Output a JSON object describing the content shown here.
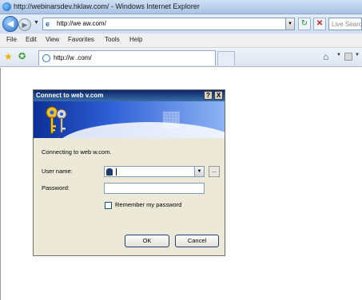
{
  "window": {
    "title": "http://webinarsdev.hklaw.com/ - Windows Internet Explorer"
  },
  "address_bar": {
    "url": "http://we                     aw.com/"
  },
  "search": {
    "placeholder": "Live Search"
  },
  "menu": {
    "items": [
      "File",
      "Edit",
      "View",
      "Favorites",
      "Tools",
      "Help"
    ]
  },
  "tab": {
    "title": "http://w                    .com/"
  },
  "dialog": {
    "title": "Connect to web                    v.com",
    "help": "?",
    "close": "X",
    "connecting_text": "Connecting to web                 w.com.",
    "user_label": "User name:",
    "password_label": "Password:",
    "remember_label": "Remember my password",
    "ok_label": "OK",
    "cancel_label": "Cancel",
    "user_value": "",
    "password_value": "",
    "remember_checked": false
  },
  "icons": {
    "back": "back-arrow-icon",
    "forward": "forward-arrow-icon",
    "refresh": "refresh-icon",
    "stop": "stop-icon",
    "favorites": "favorites-star-icon",
    "home": "home-icon",
    "keys": "keys-icon"
  },
  "colors": {
    "title_bar": "#a9c3e4",
    "dialog_title": "#0a246a",
    "dialog_bg": "#ece9d8"
  }
}
